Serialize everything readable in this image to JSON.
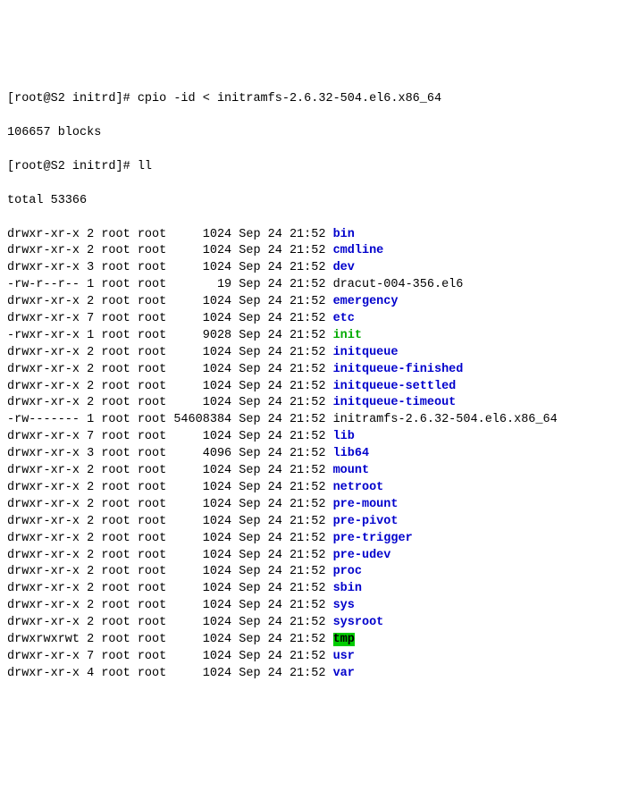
{
  "prompt1": {
    "raw": "[root@S2 initrd]# ",
    "command": "cpio -id < initramfs-2.6.32-504.el6.x86_64"
  },
  "blocks_line": "106657 blocks",
  "prompt2": {
    "raw": "[root@S2 initrd]# ",
    "command": "ll"
  },
  "total_line": "total 53366",
  "entries": [
    {
      "perms": "drwxr-xr-x",
      "links": "2",
      "owner": "root",
      "group": "root",
      "size": "1024",
      "date": "Sep 24 21:52",
      "name": "bin",
      "kind": "dir"
    },
    {
      "perms": "drwxr-xr-x",
      "links": "2",
      "owner": "root",
      "group": "root",
      "size": "1024",
      "date": "Sep 24 21:52",
      "name": "cmdline",
      "kind": "dir"
    },
    {
      "perms": "drwxr-xr-x",
      "links": "3",
      "owner": "root",
      "group": "root",
      "size": "1024",
      "date": "Sep 24 21:52",
      "name": "dev",
      "kind": "dir"
    },
    {
      "perms": "-rw-r--r--",
      "links": "1",
      "owner": "root",
      "group": "root",
      "size": "19",
      "date": "Sep 24 21:52",
      "name": "dracut-004-356.el6",
      "kind": "file"
    },
    {
      "perms": "drwxr-xr-x",
      "links": "2",
      "owner": "root",
      "group": "root",
      "size": "1024",
      "date": "Sep 24 21:52",
      "name": "emergency",
      "kind": "dir"
    },
    {
      "perms": "drwxr-xr-x",
      "links": "7",
      "owner": "root",
      "group": "root",
      "size": "1024",
      "date": "Sep 24 21:52",
      "name": "etc",
      "kind": "dir"
    },
    {
      "perms": "-rwxr-xr-x",
      "links": "1",
      "owner": "root",
      "group": "root",
      "size": "9028",
      "date": "Sep 24 21:52",
      "name": "init",
      "kind": "exec"
    },
    {
      "perms": "drwxr-xr-x",
      "links": "2",
      "owner": "root",
      "group": "root",
      "size": "1024",
      "date": "Sep 24 21:52",
      "name": "initqueue",
      "kind": "dir"
    },
    {
      "perms": "drwxr-xr-x",
      "links": "2",
      "owner": "root",
      "group": "root",
      "size": "1024",
      "date": "Sep 24 21:52",
      "name": "initqueue-finished",
      "kind": "dir"
    },
    {
      "perms": "drwxr-xr-x",
      "links": "2",
      "owner": "root",
      "group": "root",
      "size": "1024",
      "date": "Sep 24 21:52",
      "name": "initqueue-settled",
      "kind": "dir"
    },
    {
      "perms": "drwxr-xr-x",
      "links": "2",
      "owner": "root",
      "group": "root",
      "size": "1024",
      "date": "Sep 24 21:52",
      "name": "initqueue-timeout",
      "kind": "dir"
    },
    {
      "perms": "-rw-------",
      "links": "1",
      "owner": "root",
      "group": "root",
      "size": "54608384",
      "date": "Sep 24 21:52",
      "name": "initramfs-2.6.32-504.el6.x86_64",
      "kind": "file"
    },
    {
      "perms": "drwxr-xr-x",
      "links": "7",
      "owner": "root",
      "group": "root",
      "size": "1024",
      "date": "Sep 24 21:52",
      "name": "lib",
      "kind": "dir"
    },
    {
      "perms": "drwxr-xr-x",
      "links": "3",
      "owner": "root",
      "group": "root",
      "size": "4096",
      "date": "Sep 24 21:52",
      "name": "lib64",
      "kind": "dir"
    },
    {
      "perms": "drwxr-xr-x",
      "links": "2",
      "owner": "root",
      "group": "root",
      "size": "1024",
      "date": "Sep 24 21:52",
      "name": "mount",
      "kind": "dir"
    },
    {
      "perms": "drwxr-xr-x",
      "links": "2",
      "owner": "root",
      "group": "root",
      "size": "1024",
      "date": "Sep 24 21:52",
      "name": "netroot",
      "kind": "dir"
    },
    {
      "perms": "drwxr-xr-x",
      "links": "2",
      "owner": "root",
      "group": "root",
      "size": "1024",
      "date": "Sep 24 21:52",
      "name": "pre-mount",
      "kind": "dir"
    },
    {
      "perms": "drwxr-xr-x",
      "links": "2",
      "owner": "root",
      "group": "root",
      "size": "1024",
      "date": "Sep 24 21:52",
      "name": "pre-pivot",
      "kind": "dir"
    },
    {
      "perms": "drwxr-xr-x",
      "links": "2",
      "owner": "root",
      "group": "root",
      "size": "1024",
      "date": "Sep 24 21:52",
      "name": "pre-trigger",
      "kind": "dir"
    },
    {
      "perms": "drwxr-xr-x",
      "links": "2",
      "owner": "root",
      "group": "root",
      "size": "1024",
      "date": "Sep 24 21:52",
      "name": "pre-udev",
      "kind": "dir"
    },
    {
      "perms": "drwxr-xr-x",
      "links": "2",
      "owner": "root",
      "group": "root",
      "size": "1024",
      "date": "Sep 24 21:52",
      "name": "proc",
      "kind": "dir"
    },
    {
      "perms": "drwxr-xr-x",
      "links": "2",
      "owner": "root",
      "group": "root",
      "size": "1024",
      "date": "Sep 24 21:52",
      "name": "sbin",
      "kind": "dir"
    },
    {
      "perms": "drwxr-xr-x",
      "links": "2",
      "owner": "root",
      "group": "root",
      "size": "1024",
      "date": "Sep 24 21:52",
      "name": "sys",
      "kind": "dir"
    },
    {
      "perms": "drwxr-xr-x",
      "links": "2",
      "owner": "root",
      "group": "root",
      "size": "1024",
      "date": "Sep 24 21:52",
      "name": "sysroot",
      "kind": "dir"
    },
    {
      "perms": "drwxrwxrwt",
      "links": "2",
      "owner": "root",
      "group": "root",
      "size": "1024",
      "date": "Sep 24 21:52",
      "name": "tmp",
      "kind": "sticky"
    },
    {
      "perms": "drwxr-xr-x",
      "links": "7",
      "owner": "root",
      "group": "root",
      "size": "1024",
      "date": "Sep 24 21:52",
      "name": "usr",
      "kind": "dir"
    },
    {
      "perms": "drwxr-xr-x",
      "links": "4",
      "owner": "root",
      "group": "root",
      "size": "1024",
      "date": "Sep 24 21:52",
      "name": "var",
      "kind": "dir"
    }
  ],
  "size_col_width": 8
}
